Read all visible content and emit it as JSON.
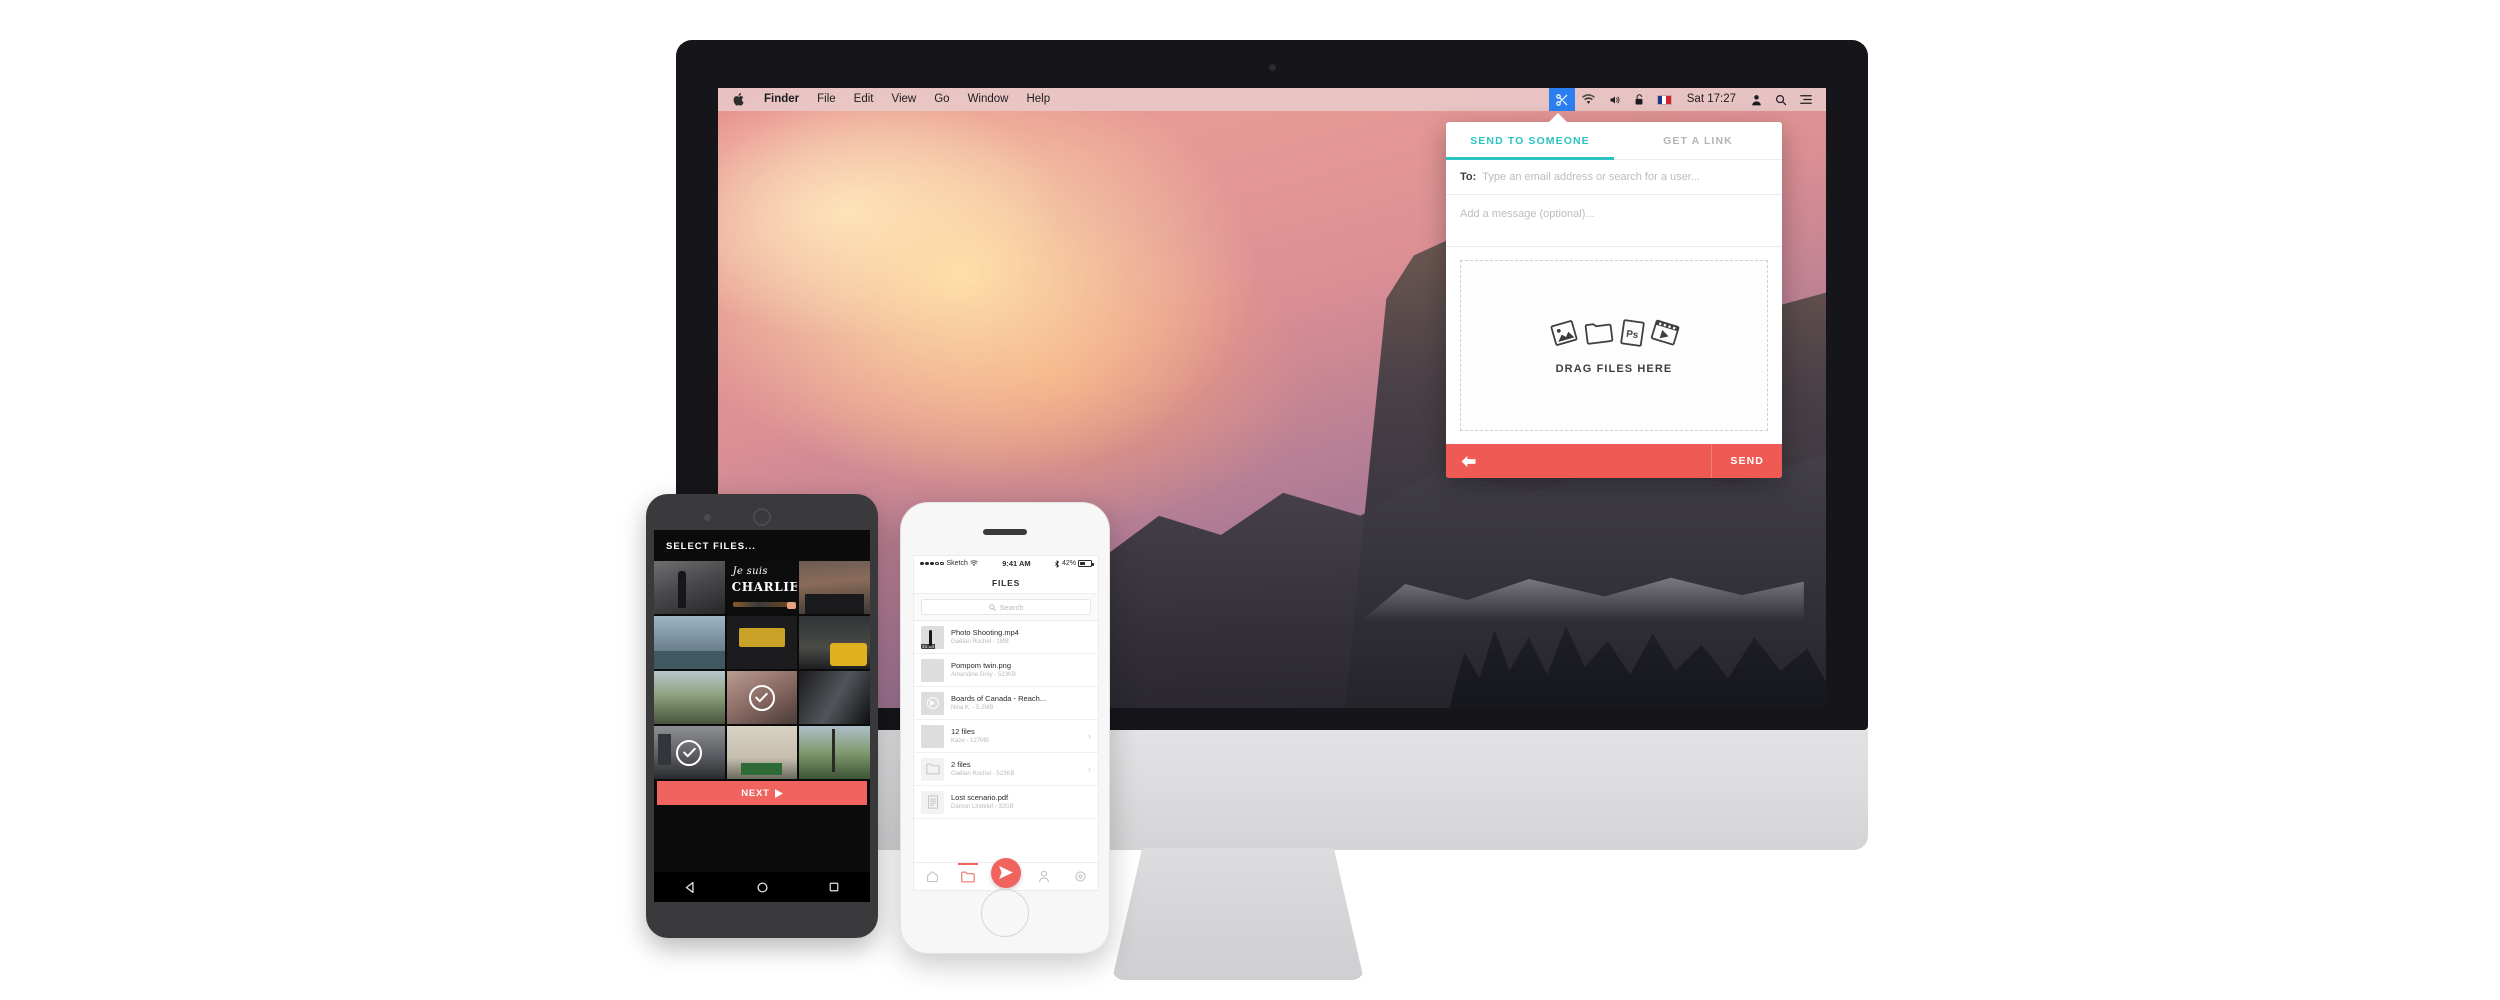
{
  "desktop": {
    "menubar": {
      "apple_icon": "apple-icon",
      "items": [
        "Finder",
        "File",
        "Edit",
        "View",
        "Go",
        "Window",
        "Help"
      ],
      "status_icons": [
        "scissors-icon",
        "wifi-icon",
        "volume-icon",
        "lock-icon",
        "french-flag-icon"
      ],
      "clock": "Sat 17:27",
      "right_icons": [
        "user-icon",
        "search-icon",
        "notification-center-icon"
      ]
    }
  },
  "popover": {
    "tabs": [
      {
        "label": "SEND TO SOMEONE",
        "selected": true
      },
      {
        "label": "GET A LINK",
        "selected": false
      }
    ],
    "to_label": "To:",
    "to_placeholder": "Type an email address or search for a user...",
    "message_placeholder": "Add a message (optional)...",
    "dropzone": {
      "label": "DRAG FILES HERE",
      "icons": [
        "image-file-icon",
        "folder-icon",
        "photoshop-file-icon",
        "video-file-icon"
      ],
      "photoshop_label": "Ps"
    },
    "footer": {
      "back_icon": "back-arrow-icon",
      "send_label": "SEND"
    },
    "accent_color": "#2cc3c3",
    "action_color": "#ef5a54"
  },
  "android": {
    "title": "SELECT FILES...",
    "next_label": "NEXT",
    "next_icon": "play-arrow-icon",
    "nav_icons": [
      "back-triangle-icon",
      "home-circle-icon",
      "recents-square-icon"
    ],
    "tiles": [
      {
        "art": "t-street",
        "selected": false
      },
      {
        "art": "t-charlie",
        "selected": false,
        "line1": "Je suis",
        "line2": "CHARLIE"
      },
      {
        "art": "t-house",
        "selected": false
      },
      {
        "art": "t-canal",
        "selected": false
      },
      {
        "art": "t-friends",
        "selected": false
      },
      {
        "art": "t-digger",
        "selected": false
      },
      {
        "art": "t-field",
        "selected": false
      },
      {
        "art": "t-bed",
        "selected": true
      },
      {
        "art": "t-tunnel",
        "selected": false
      },
      {
        "art": "t-bldg",
        "selected": true
      },
      {
        "art": "t-poster",
        "selected": false
      },
      {
        "art": "t-park",
        "selected": false
      }
    ]
  },
  "iphone": {
    "status": {
      "carrier": "Sketch",
      "time": "9:41 AM",
      "battery": "42%",
      "signal_dots": 5,
      "signal_filled": 3
    },
    "nav_title": "FILES",
    "search_placeholder": "Search",
    "files": [
      {
        "name": "Photo Shooting.mp4",
        "sub": "Gaëtan Rochel - 1MB",
        "thumb": "t-street",
        "kind": "video",
        "duration": "31:04",
        "chevron": false
      },
      {
        "name": "Pompom twin.png",
        "sub": "Amandine Grey - 523KB",
        "thumb": "t-bed",
        "kind": "image",
        "chevron": false
      },
      {
        "name": "Boards of Canada - Reach...",
        "sub": "Nina K. - 5.2MB",
        "thumb": "t-field",
        "kind": "audio",
        "chevron": false
      },
      {
        "name": "12 files",
        "sub": "Kaze - 127MB",
        "thumb": "t-charlie",
        "kind": "album",
        "chevron": true
      },
      {
        "name": "2 files",
        "sub": "Gaëtan Rochel - 523KB",
        "thumb": "folder",
        "kind": "folder",
        "chevron": true
      },
      {
        "name": "Lost scenario.pdf",
        "sub": "Damon Lindelof - 32GB",
        "thumb": "doc",
        "kind": "doc",
        "chevron": false
      }
    ],
    "tabs": [
      {
        "icon": "home-icon",
        "active": false
      },
      {
        "icon": "folder-icon",
        "active": true
      },
      {
        "icon": "send-icon",
        "active": false,
        "fab": true
      },
      {
        "icon": "person-icon",
        "active": false
      },
      {
        "icon": "gear-icon",
        "active": false
      }
    ]
  }
}
